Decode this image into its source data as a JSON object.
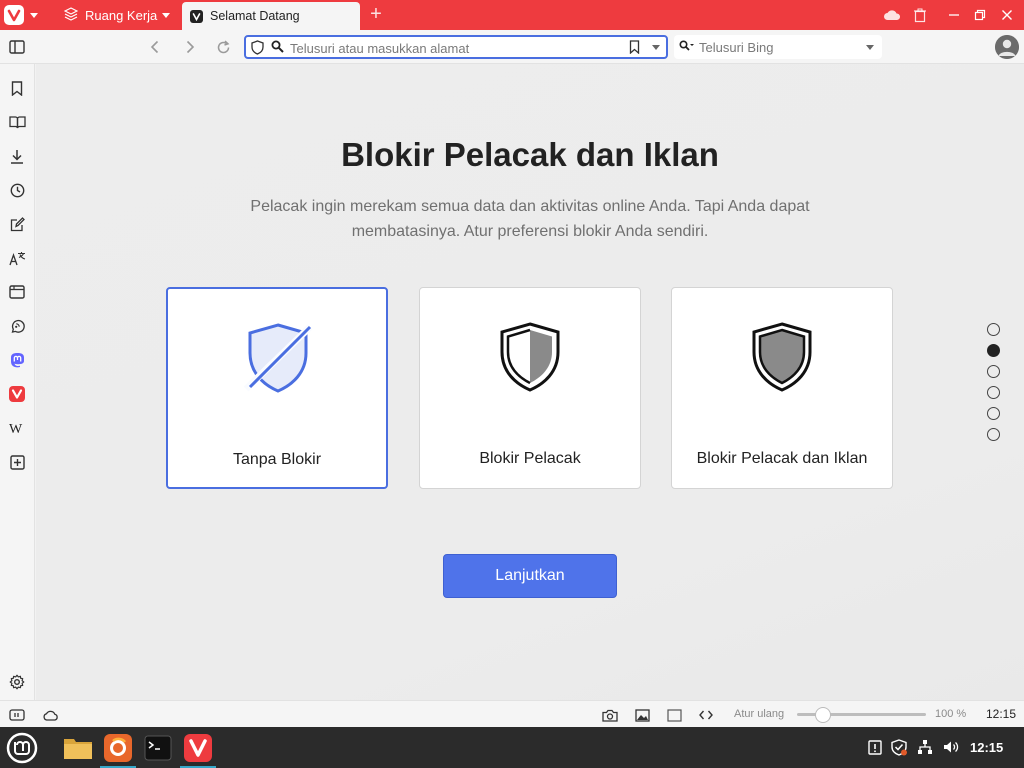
{
  "browser": {
    "workspace_tab": "Ruang Kerja",
    "active_tab": "Selamat Datang",
    "address_placeholder": "Telusuri atau masukkan alamat",
    "search_placeholder": "Telusuri Bing"
  },
  "content": {
    "title": "Blokir Pelacak dan Iklan",
    "subtitle": "Pelacak ingin merekam semua data dan aktivitas online Anda. Tapi Anda dapat membatasinya. Atur preferensi blokir Anda sendiri.",
    "options": [
      {
        "label": "Tanpa Blokir",
        "icon": "shield-off-icon",
        "selected": true
      },
      {
        "label": "Blokir Pelacak",
        "icon": "shield-half-icon",
        "selected": false
      },
      {
        "label": "Blokir Pelacak dan Iklan",
        "icon": "shield-full-icon",
        "selected": false
      }
    ],
    "continue_label": "Lanjutkan",
    "pagination": {
      "total": 6,
      "current": 2
    }
  },
  "statusbar": {
    "reset_label": "Atur ulang",
    "zoom_label": "100 %",
    "time": "12:15"
  },
  "taskbar": {
    "time": "12:15"
  },
  "colors": {
    "tab_bar": "#ee3b3f",
    "accent": "#4f73ea",
    "selected_border": "#4a6ee0"
  }
}
